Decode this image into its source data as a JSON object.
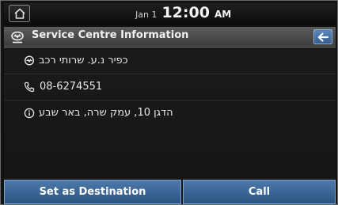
{
  "status": {
    "date": "Jan 1",
    "time": "12:00",
    "ampm": "AM"
  },
  "header": {
    "title": "Service Centre Information"
  },
  "details": {
    "name": "כפיר נ.ע. שרותי רכב",
    "phone": "08-6274551",
    "address": "הדגן 10, עמק שרה, באר שבע"
  },
  "actions": {
    "set_destination": "Set as Destination",
    "call": "Call"
  },
  "colors": {
    "button_blue": "#3d6a9c",
    "titlebar_gray": "#4a4a4a",
    "background": "#161616"
  }
}
